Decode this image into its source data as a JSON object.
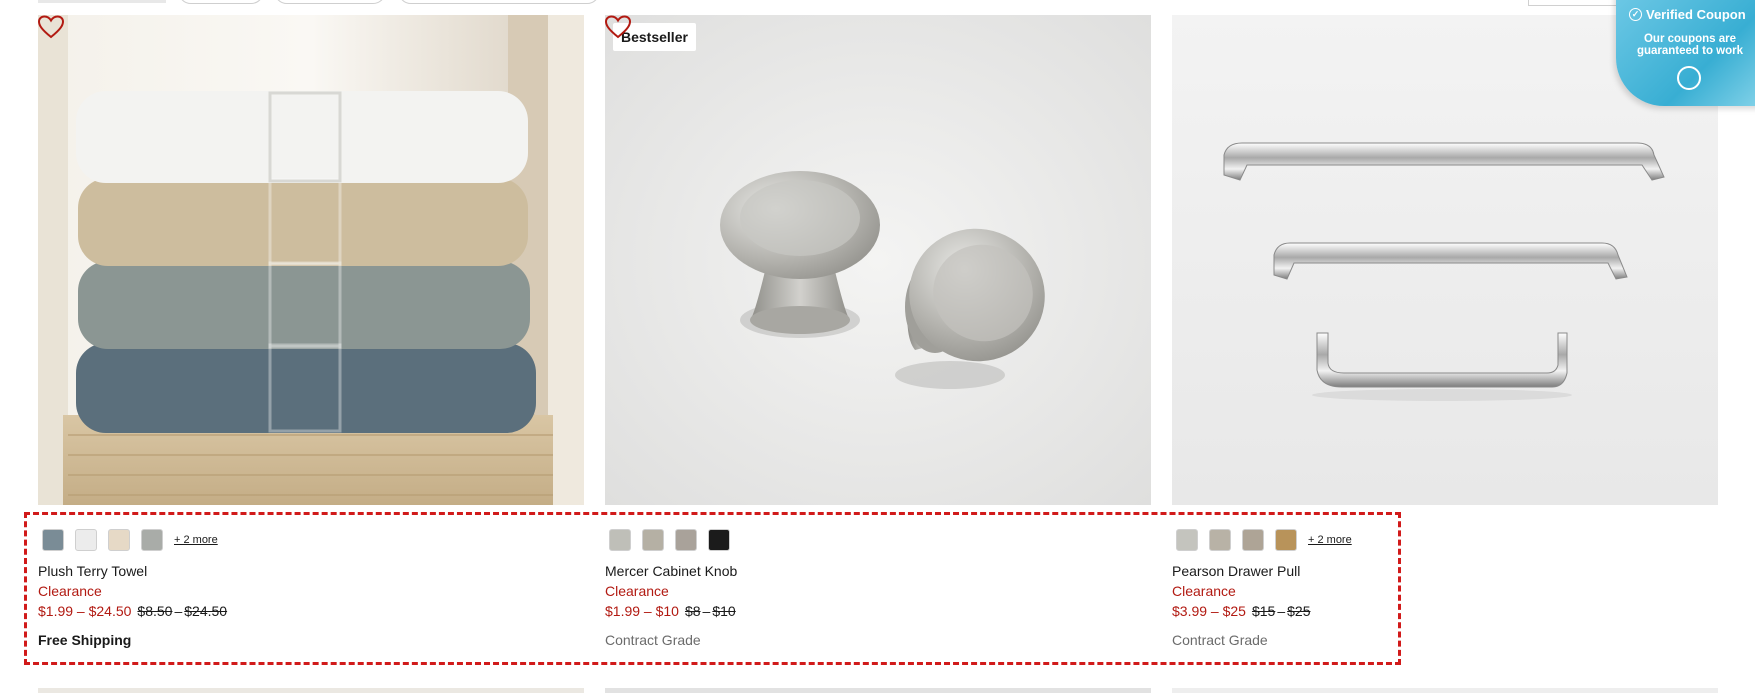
{
  "products": [
    {
      "name": "Plush Terry Towel",
      "tag": "Clearance",
      "sale_price": "$1.99 – $24.50",
      "orig_low": "$8.50",
      "orig_dash": "–",
      "orig_high": "$24.50",
      "extra": "Free Shipping",
      "more_swatches": "+ 2 more",
      "swatches": [
        "#7a8c96",
        "#ececec",
        "#e6d9c6",
        "#a9aca8"
      ]
    },
    {
      "name": "Mercer Cabinet Knob",
      "tag": "Clearance",
      "badge": "Bestseller",
      "sale_price": "$1.99 – $10",
      "orig_low": "$8",
      "orig_dash": "–",
      "orig_high": "$10",
      "extra": "Contract Grade",
      "swatches": [
        "#bfbfb8",
        "#b5b0a4",
        "#a9a29a",
        "#1b1b1b"
      ]
    },
    {
      "name": "Pearson Drawer Pull",
      "tag": "Clearance",
      "sale_price": "$3.99 – $25",
      "orig_low": "$15",
      "orig_dash": "–",
      "orig_high": "$25",
      "extra": "Contract Grade",
      "more_swatches": "+ 2 more",
      "swatches": [
        "#c4c4be",
        "#b8b2a6",
        "#aea496",
        "#b8935a"
      ]
    }
  ],
  "coupon": {
    "title": "Verified Coupon",
    "body": "Our coupons are guaranteed to work"
  },
  "colors": {
    "sale": "#b21a12",
    "accent_outline": "#d11a1a"
  }
}
